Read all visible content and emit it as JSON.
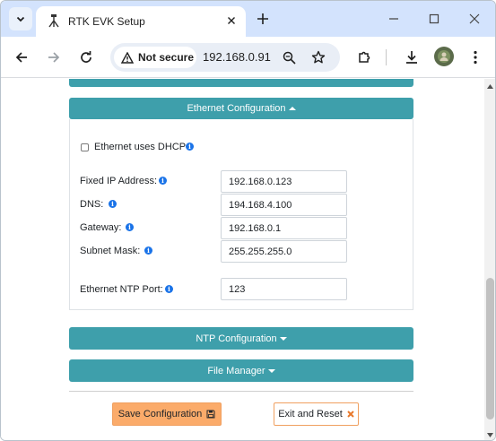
{
  "browser": {
    "tab": {
      "title": "RTK EVK Setup"
    },
    "omnibox": {
      "security_label": "Not secure",
      "url": "192.168.0.91"
    }
  },
  "page": {
    "sections": {
      "ethernet": {
        "label": "Ethernet Configuration",
        "state": "expanded"
      },
      "ntp": {
        "label": "NTP Configuration",
        "state": "collapsed"
      },
      "file_manager": {
        "label": "File Manager",
        "state": "collapsed"
      }
    },
    "ethernet_form": {
      "dhcp": {
        "label": "Ethernet uses DHCP",
        "checked": false
      },
      "fixed_ip": {
        "label": "Fixed IP Address:",
        "value": "192.168.0.123"
      },
      "dns": {
        "label": "DNS:",
        "value": "194.168.4.100"
      },
      "gateway": {
        "label": "Gateway:",
        "value": "192.168.0.1"
      },
      "subnet": {
        "label": "Subnet Mask:",
        "value": "255.255.255.0"
      },
      "ntp_port": {
        "label": "Ethernet NTP Port:",
        "value": "123"
      }
    },
    "actions": {
      "save_label": "Save Configuration",
      "exit_label": "Exit and Reset"
    }
  },
  "colors": {
    "section_bar": "#3e9fab",
    "save_button": "#fbab6a",
    "exit_icon": "#e8782a",
    "info_icon": "#1a73e8",
    "tab_strip": "#d3e3fd"
  },
  "icons": {
    "tab_favicon": "tripod-icon",
    "info": "info-circle-icon",
    "save": "floppy-disk-icon",
    "exit": "close-x-icon"
  }
}
